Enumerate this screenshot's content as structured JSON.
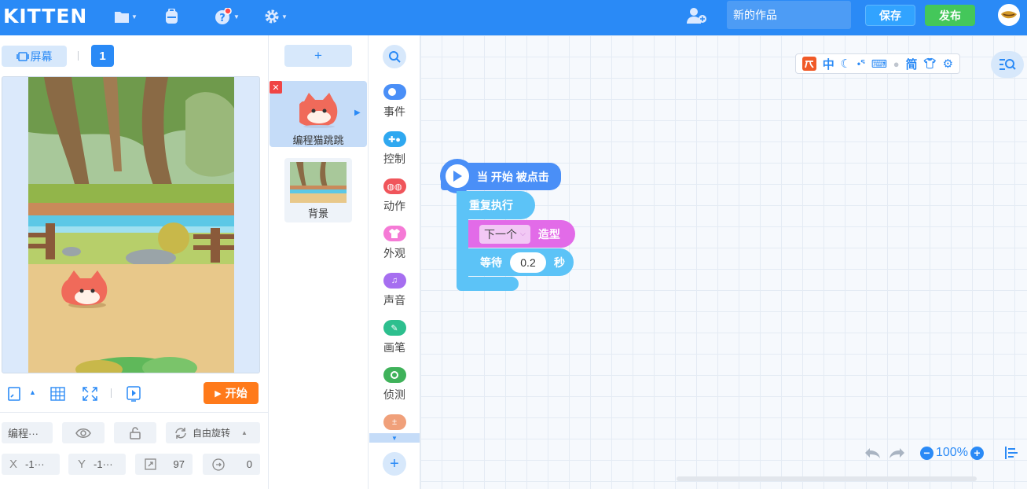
{
  "app": {
    "logo": "KITTEN"
  },
  "header": {
    "project_title_placeholder": "新的作品",
    "save_label": "保存",
    "publish_label": "发布"
  },
  "stage": {
    "screen_label": "屏幕",
    "page_number": "1",
    "start_label": "开始"
  },
  "sprite_props": {
    "name": "编程···",
    "rotation_label": "自由旋转",
    "x_label": "X",
    "x_value": "-1···",
    "y_label": "Y",
    "y_value": "-1···",
    "size_value": "97",
    "direction_value": "0"
  },
  "sprites": {
    "add_label": "+",
    "items": [
      {
        "name": "编程猫跳跳"
      }
    ],
    "background_label": "背景"
  },
  "categories": [
    {
      "label": "事件",
      "color": "#4a8ff7"
    },
    {
      "label": "控制",
      "color": "#2fa8f0"
    },
    {
      "label": "动作",
      "color": "#f0555b"
    },
    {
      "label": "外观",
      "color": "#f57ad6"
    },
    {
      "label": "声音",
      "color": "#a66ef0"
    },
    {
      "label": "画笔",
      "color": "#2dbf8e"
    },
    {
      "label": "侦测",
      "color": "#3fb25a"
    },
    {
      "label": "",
      "color": "#f0a07a"
    }
  ],
  "workspace_toolbar": {
    "lang": "中",
    "simplified": "简"
  },
  "blocks": {
    "hat_label": "当 开始 被点击",
    "repeat_label": "重复执行",
    "costume_dropdown": "下一个",
    "costume_label": "造型",
    "wait_label": "等待",
    "wait_value": "0.2",
    "wait_unit": "秒"
  },
  "zoom": {
    "level": "100%"
  }
}
